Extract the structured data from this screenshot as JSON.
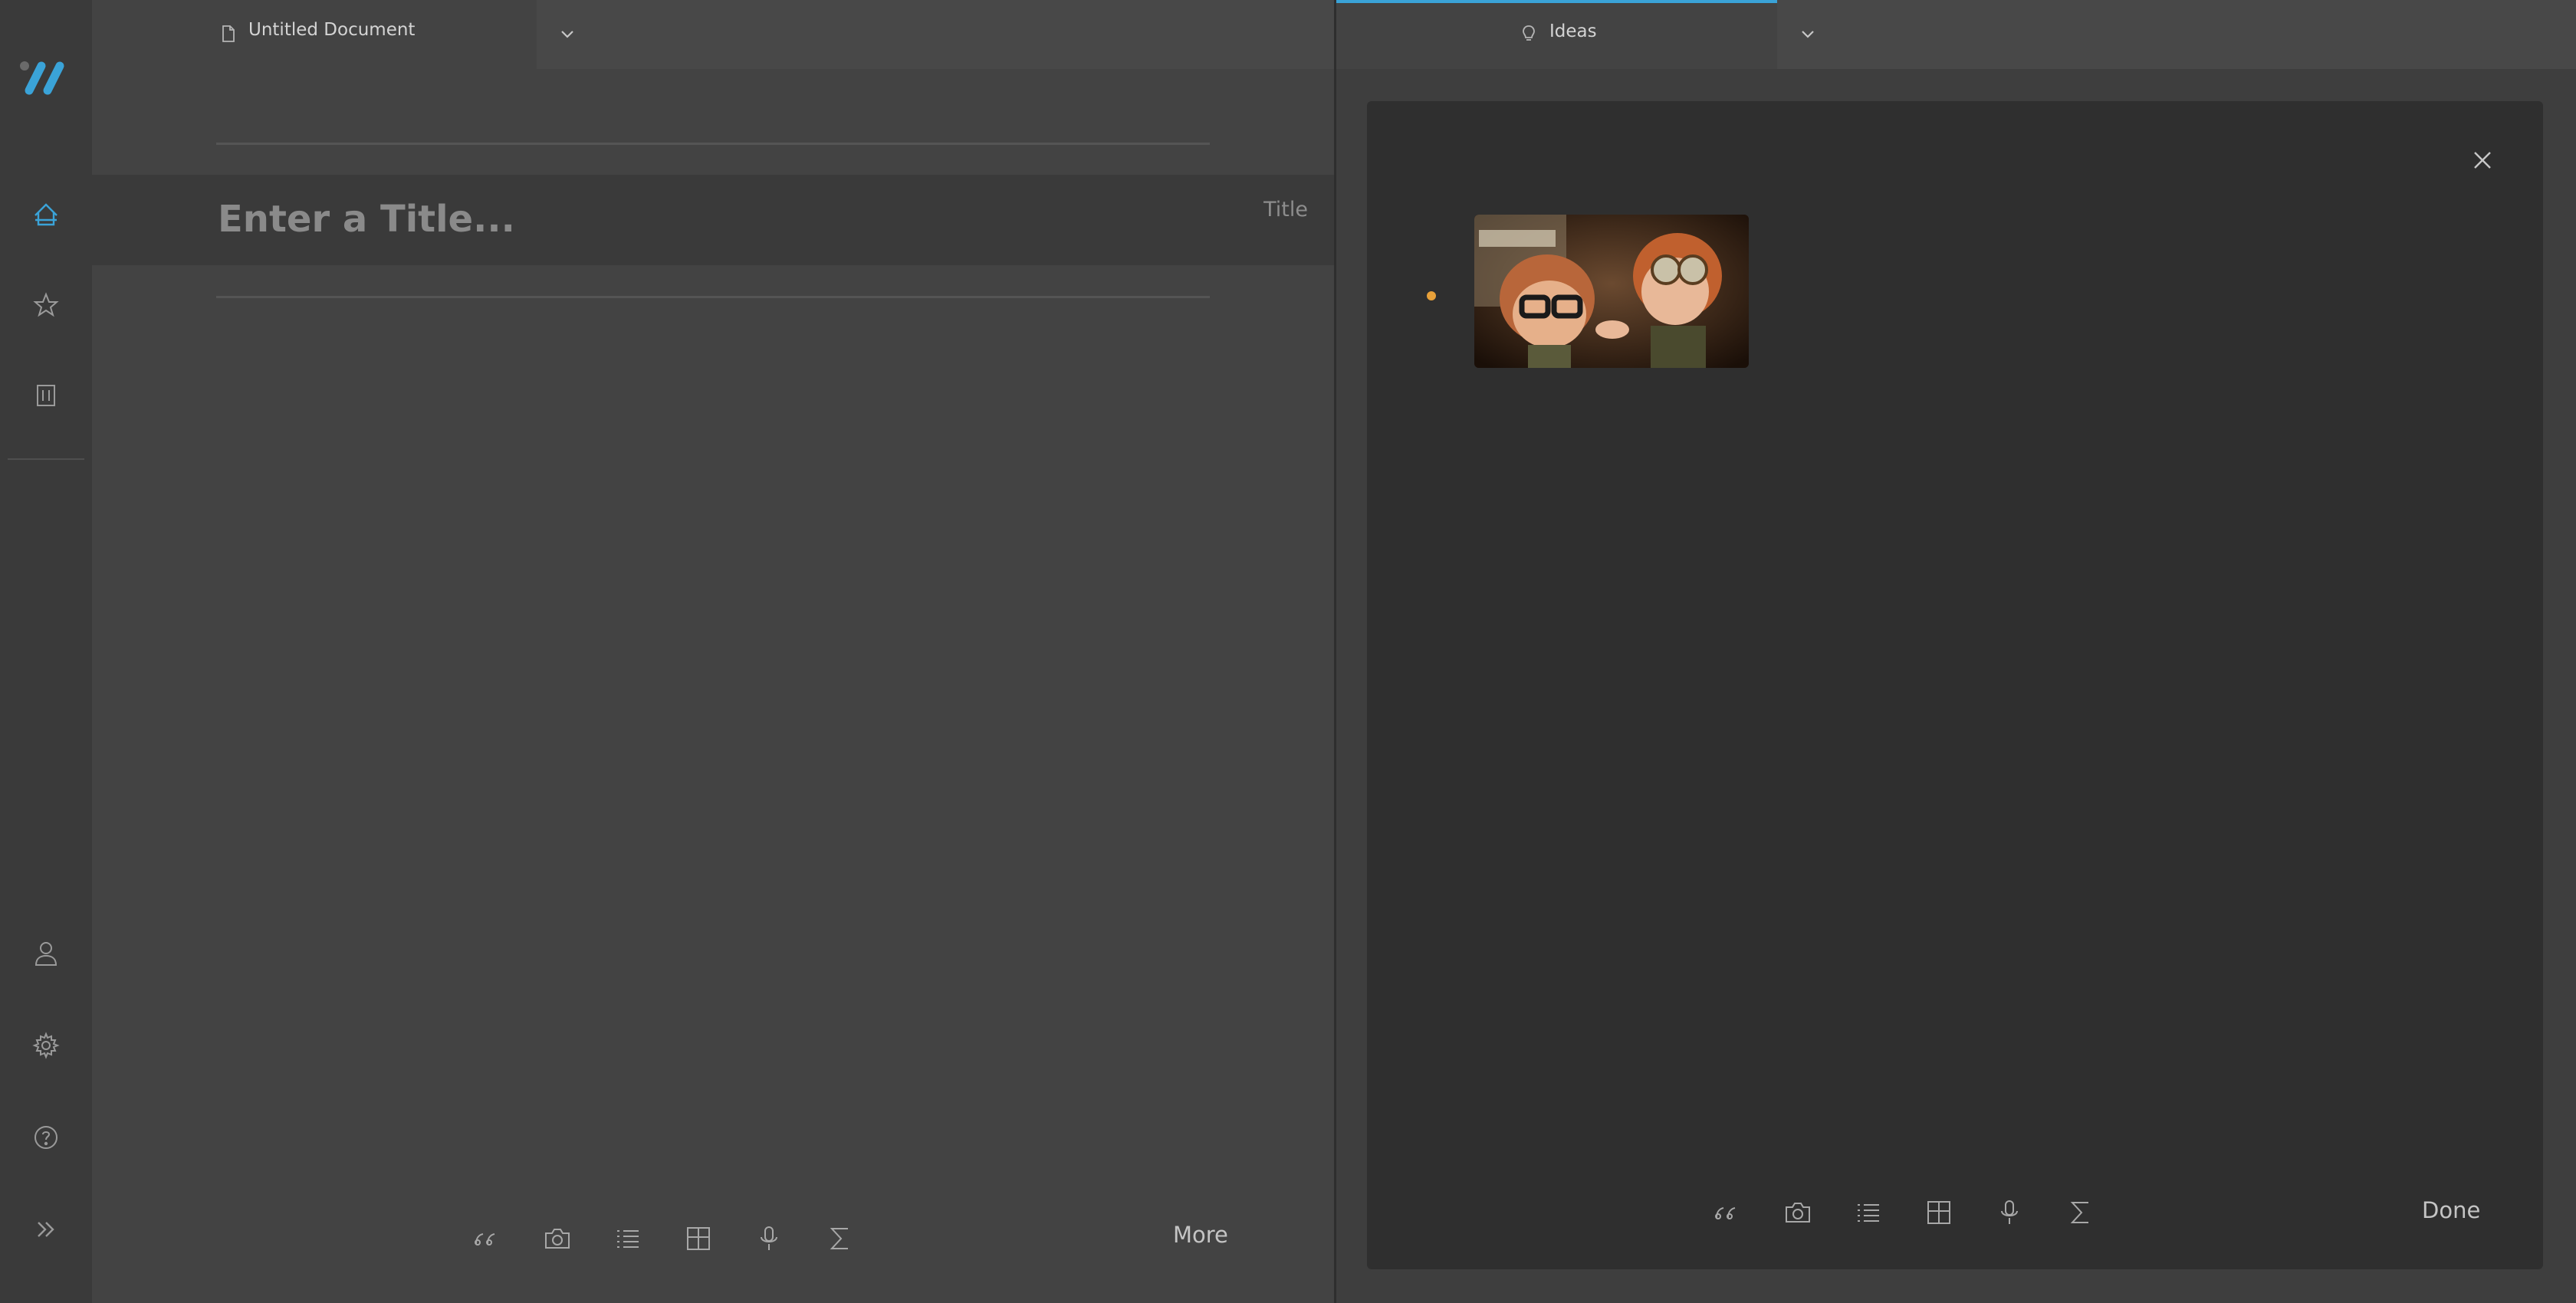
{
  "sidebar": {
    "logo": "app-logo",
    "items": [
      {
        "name": "home",
        "icon": "home-icon",
        "active": true
      },
      {
        "name": "favorites",
        "icon": "star-icon"
      },
      {
        "name": "trash",
        "icon": "trash-icon"
      }
    ],
    "bottom": [
      {
        "name": "account",
        "icon": "user-icon"
      },
      {
        "name": "settings",
        "icon": "gear-icon"
      },
      {
        "name": "help",
        "icon": "help-icon"
      },
      {
        "name": "expand",
        "icon": "double-chevron-right-icon"
      }
    ]
  },
  "left_pane": {
    "tab_label": "Untitled Document",
    "title_placeholder": "Enter a Title...",
    "title_tag": "Title",
    "toolbar": [
      "quote-icon",
      "camera-icon",
      "list-icon",
      "table-icon",
      "microphone-icon",
      "sigma-icon"
    ],
    "more_label": "More"
  },
  "right_pane": {
    "tab_label": "Ideas",
    "image_alt": "Two cartoon kids in aviator goggles",
    "toolbar": [
      "quote-icon",
      "camera-icon",
      "list-icon",
      "table-icon",
      "microphone-icon",
      "sigma-icon"
    ],
    "done_label": "Done"
  },
  "colors": {
    "accent": "#3aa3d8",
    "bullet": "#e8a13a",
    "background": "#3f3f3f",
    "panel": "#2f2f2f"
  }
}
